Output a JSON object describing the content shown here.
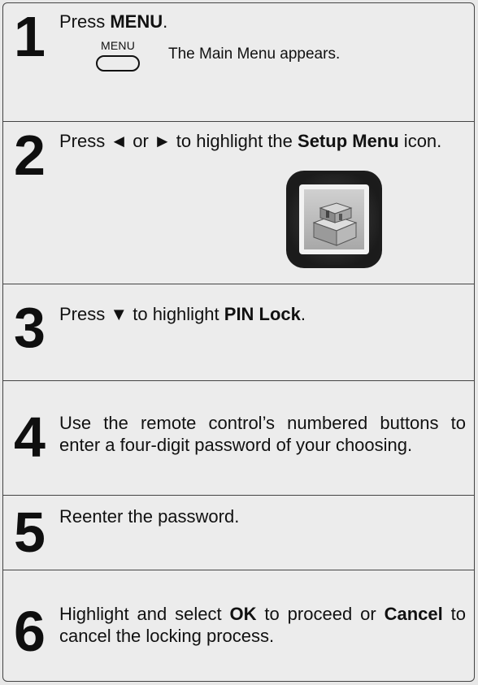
{
  "steps": [
    {
      "number": "1",
      "parts": [
        {
          "text": "Press ",
          "bold": false
        },
        {
          "text": "MENU",
          "bold": true
        },
        {
          "text": ".",
          "bold": false
        }
      ],
      "button_label": "MENU",
      "note": "The Main Menu appears."
    },
    {
      "number": "2",
      "parts": [
        {
          "text": "Press ◄ or ► to highlight the ",
          "bold": false
        },
        {
          "text": "Setup Menu",
          "bold": true
        },
        {
          "text": " icon.",
          "bold": false
        }
      ],
      "icon": "setup-menu-icon"
    },
    {
      "number": "3",
      "parts": [
        {
          "text": "Press ▼ to highlight ",
          "bold": false
        },
        {
          "text": "PIN Lock",
          "bold": true
        },
        {
          "text": ".",
          "bold": false
        }
      ]
    },
    {
      "number": "4",
      "parts": [
        {
          "text": "Use the remote control’s numbered buttons to enter a four-digit password of your choosing.",
          "bold": false
        }
      ]
    },
    {
      "number": "5",
      "parts": [
        {
          "text": "Reenter the password.",
          "bold": false
        }
      ]
    },
    {
      "number": "6",
      "parts": [
        {
          "text": "Highlight and select ",
          "bold": false
        },
        {
          "text": "OK",
          "bold": true
        },
        {
          "text": " to proceed or ",
          "bold": false
        },
        {
          "text": "Cancel",
          "bold": true
        },
        {
          "text": " to cancel the locking process.",
          "bold": false
        }
      ]
    }
  ]
}
